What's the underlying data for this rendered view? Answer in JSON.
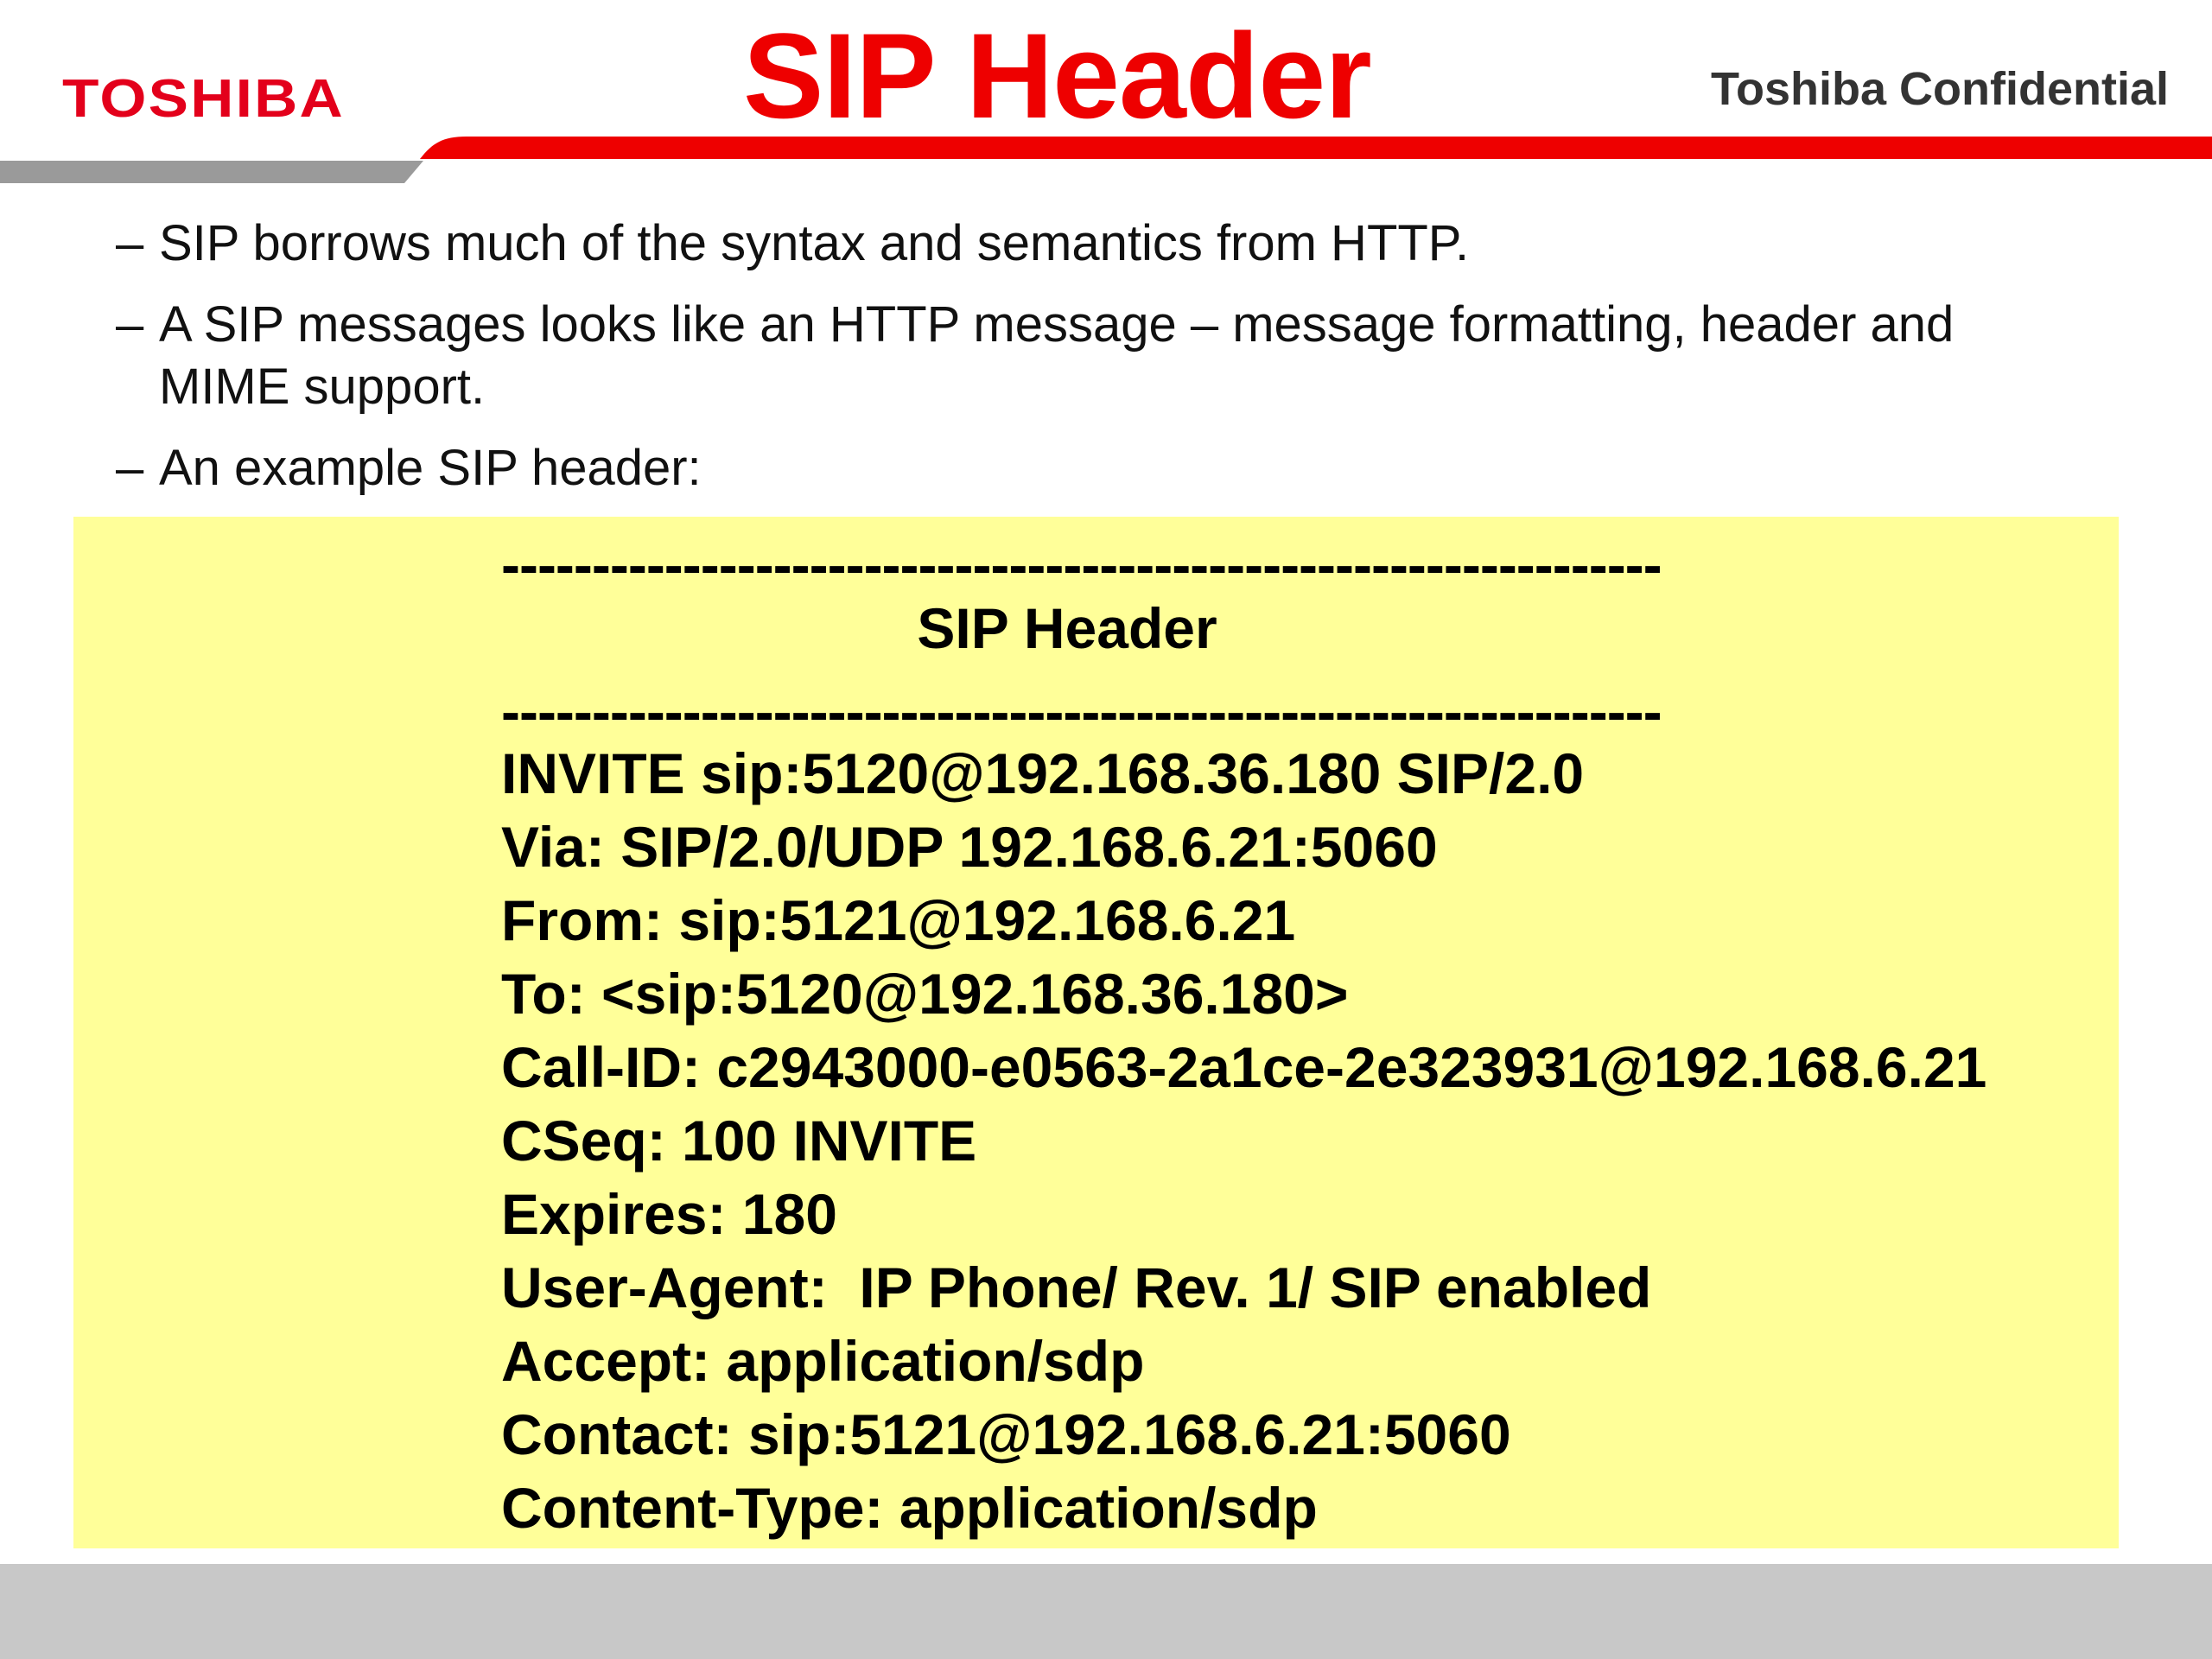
{
  "header": {
    "logo": "TOSHIBA",
    "title": "SIP Header",
    "confidential": "Toshiba Confidential"
  },
  "bullets": [
    {
      "dash": "–",
      "text": "SIP borrows much of the syntax and semantics from HTTP."
    },
    {
      "dash": "–",
      "text": "A SIP messages looks like an HTTP message – message formatting, header and MIME support."
    },
    {
      "dash": "–",
      "text": "An example SIP header:"
    }
  ],
  "example": {
    "rule": "----------------------------------------------------------------",
    "heading": "SIP Header",
    "lines": [
      "INVITE sip:5120@192.168.36.180 SIP/2.0",
      "Via: SIP/2.0/UDP 192.168.6.21:5060",
      "From: sip:5121@192.168.6.21",
      "To: <sip:5120@192.168.36.180>",
      "Call-ID: c2943000-e0563-2a1ce-2e323931@192.168.6.21",
      "CSeq: 100 INVITE",
      "Expires: 180",
      "User-Agent:  IP Phone/ Rev. 1/ SIP enabled",
      "Accept: application/sdp",
      "Contact: sip:5121@192.168.6.21:5060",
      "Content-Type: application/sdp"
    ]
  },
  "colors": {
    "brand_red": "#e3001b",
    "title_red": "#ee0000",
    "band_gray": "#9a9a9a",
    "highlight_yellow": "#ffff99",
    "footer_gray": "#c8c8c8"
  }
}
